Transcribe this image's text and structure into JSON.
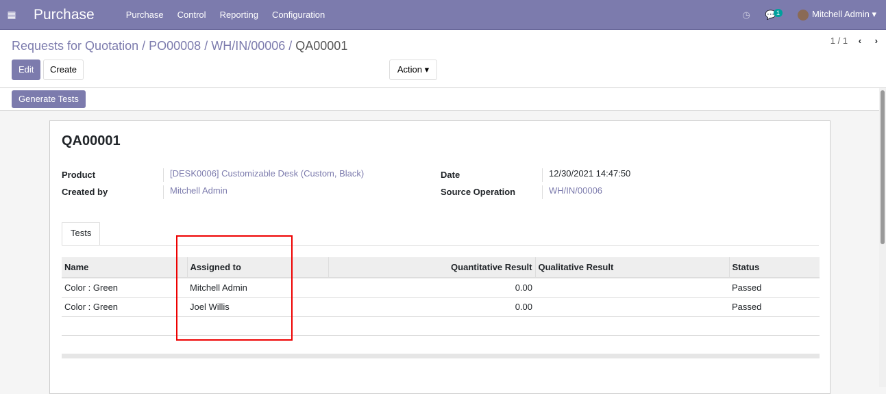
{
  "nav": {
    "app": "Purchase",
    "menus": [
      "Purchase",
      "Control",
      "Reporting",
      "Configuration"
    ],
    "messages_count": "1",
    "user": "Mitchell Admin"
  },
  "breadcrumb": [
    "Requests for Quotation",
    "PO00008",
    "WH/IN/00006"
  ],
  "breadcrumb_current": "QA00001",
  "sep": " / ",
  "buttons": {
    "edit": "Edit",
    "create": "Create",
    "action": "Action",
    "generate": "Generate Tests"
  },
  "pager": "1 / 1",
  "record": {
    "title": "QA00001",
    "product_label": "Product",
    "product": "[DESK0006] Customizable Desk (Custom, Black)",
    "created_label": "Created by",
    "created": "Mitchell Admin",
    "date_label": "Date",
    "date": "12/30/2021 14:47:50",
    "source_label": "Source Operation",
    "source": "WH/IN/00006"
  },
  "tab": "Tests",
  "table": {
    "headers": [
      "Name",
      "Assigned to",
      "Quantitative Result",
      "Qualitative Result",
      "Status"
    ],
    "rows": [
      [
        "Color : Green",
        "Mitchell Admin",
        "0.00",
        "",
        "Passed"
      ],
      [
        "Color : Green",
        "Joel Willis",
        "0.00",
        "",
        "Passed"
      ]
    ]
  }
}
